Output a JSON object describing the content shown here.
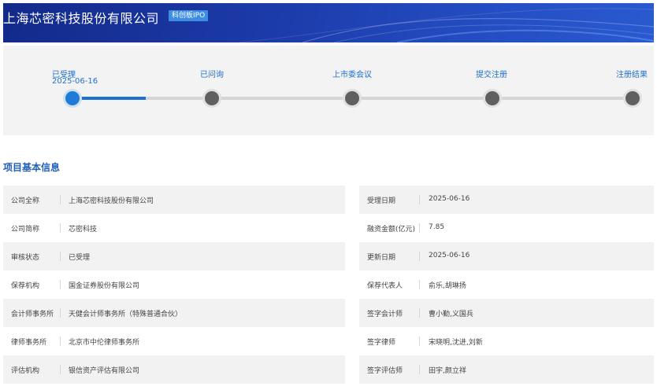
{
  "header": {
    "company_title": "上海芯密科技股份有限公司",
    "board_tag": "科创板IPO"
  },
  "progress": {
    "steps": [
      {
        "label": "已受理",
        "date": "2025-06-16",
        "active": true
      },
      {
        "label": "已问询",
        "date": "",
        "active": false
      },
      {
        "label": "上市委会议",
        "date": "",
        "active": false
      },
      {
        "label": "提交注册",
        "date": "",
        "active": false
      },
      {
        "label": "注册结果",
        "date": "",
        "active": false
      }
    ],
    "completed_fraction": 0.13
  },
  "section": {
    "title": "项目基本信息"
  },
  "info": {
    "left": [
      {
        "label": "公司全称",
        "value": "上海芯密科技股份有限公司"
      },
      {
        "label": "公司简称",
        "value": "芯密科技"
      },
      {
        "label": "审核状态",
        "value": "已受理"
      },
      {
        "label": "保荐机构",
        "value": "国金证券股份有限公司"
      },
      {
        "label": "会计师事务所",
        "value": "天健会计师事务所（特殊普通合伙）"
      },
      {
        "label": "律师事务所",
        "value": "北京市中伦律师事务所"
      },
      {
        "label": "评估机构",
        "value": "银信资产评估有限公司"
      }
    ],
    "right": [
      {
        "label": "受理日期",
        "value": "2025-06-16"
      },
      {
        "label": "融资金额(亿元)",
        "value": "7.85"
      },
      {
        "label": "更新日期",
        "value": "2025-06-16"
      },
      {
        "label": "保荐代表人",
        "value": "俞乐,胡琳扬"
      },
      {
        "label": "签字会计师",
        "value": "曹小勤,义国兵"
      },
      {
        "label": "签字律师",
        "value": "宋晓明,沈进,刘新"
      },
      {
        "label": "签字评估师",
        "value": "田宇,颜立祥"
      }
    ]
  },
  "colors": {
    "banner": "#1c3aa8",
    "accent": "#1f6fce",
    "section_title": "#1f5fb8"
  }
}
